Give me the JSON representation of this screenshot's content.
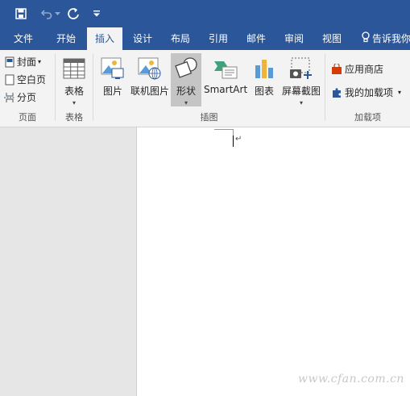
{
  "quick_access": {
    "save_icon": "save-icon",
    "undo_icon": "undo-icon",
    "redo_icon": "redo-icon",
    "customize_icon": "customize-icon"
  },
  "tabs": [
    {
      "label": "文件"
    },
    {
      "label": "开始"
    },
    {
      "label": "插入",
      "active": true
    },
    {
      "label": "设计"
    },
    {
      "label": "布局"
    },
    {
      "label": "引用"
    },
    {
      "label": "邮件"
    },
    {
      "label": "审阅"
    },
    {
      "label": "视图"
    }
  ],
  "tell_me": "告诉我你",
  "ribbon": {
    "pages_group": {
      "label": "页面",
      "cover": "封面",
      "blank": "空白页",
      "break": "分页"
    },
    "tables_group": {
      "label": "表格",
      "table": "表格"
    },
    "illustrations_group": {
      "label": "插图",
      "picture": "图片",
      "online_picture": "联机图片",
      "shapes": "形状",
      "smartart": "SmartArt",
      "chart": "图表",
      "screenshot": "屏幕截图"
    },
    "addins_group": {
      "label": "加载项",
      "store": "应用商店",
      "my_addins": "我的加载项"
    }
  },
  "document": {
    "paragraph_mark": "↵"
  },
  "watermark": "www.cfan.com.cn",
  "colors": {
    "title_bar": "#2b579a",
    "ribbon_bg": "#f3f3f3",
    "accent": "#2b579a"
  }
}
